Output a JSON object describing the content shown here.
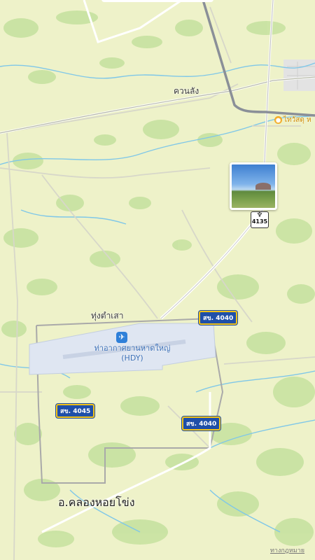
{
  "map": {
    "places": {
      "khuan_lang": "ควนลัง",
      "thung_tam_sao": "ทุ่งตำเสา",
      "district": "อ.คลองหอยโข่ง"
    },
    "airport": {
      "name": "ท่าอากาศยานหาดใหญ่",
      "code": "(HDY)",
      "icon": "airplane-icon"
    },
    "poi": {
      "label": "ไทวัสดุ ห",
      "icon": "store-icon"
    },
    "road_shields": {
      "r4040_a": "สข. 4040",
      "r4040_b": "สข. 4040",
      "r4045": "สข. 4045"
    },
    "highway_badge": "4135",
    "legal_link": "ทางกฎหมาย",
    "colors": {
      "land": "#eef2c9",
      "vegetation": "#c9e3a3",
      "water": "#7fc7e8",
      "major_road": "#8a8f98",
      "shield_blue": "#1f4fa8",
      "shield_border": "#f3c316",
      "airport_area": "#dfe6f2"
    }
  }
}
